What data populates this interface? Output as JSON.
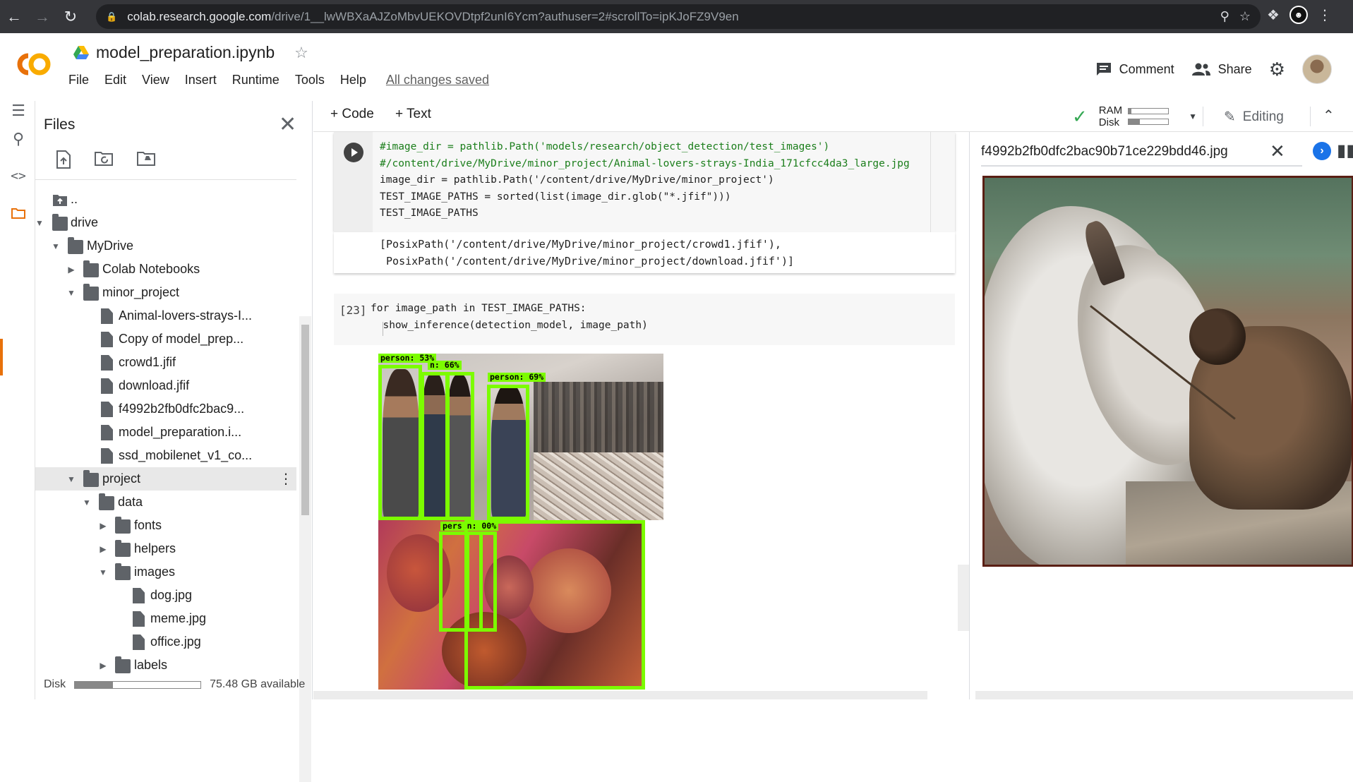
{
  "browser": {
    "url_host": "colab.research.google.com",
    "url_path": "/drive/1__lwWBXaAJZoMbvUEKOVDtpf2unI6Ycm?authuser=2#scrollTo=ipKJoFZ9V9en"
  },
  "header": {
    "doc_name": "model_preparation.ipynb",
    "menu": [
      "File",
      "Edit",
      "View",
      "Insert",
      "Runtime",
      "Tools",
      "Help"
    ],
    "saved_status": "All changes saved",
    "comment_label": "Comment",
    "share_label": "Share"
  },
  "files_panel": {
    "title": "Files",
    "disk_label": "Disk",
    "disk_available": "75.48 GB available",
    "disk_used_fraction": 0.3,
    "tree": [
      {
        "label": "..",
        "depth": 0,
        "kind": "up"
      },
      {
        "label": "drive",
        "depth": 0,
        "kind": "folder",
        "caret": "down"
      },
      {
        "label": "MyDrive",
        "depth": 1,
        "kind": "folder",
        "caret": "down"
      },
      {
        "label": "Colab Notebooks",
        "depth": 2,
        "kind": "folder",
        "caret": "right"
      },
      {
        "label": "minor_project",
        "depth": 2,
        "kind": "folder",
        "caret": "down"
      },
      {
        "label": "Animal-lovers-strays-I...",
        "depth": 3,
        "kind": "file"
      },
      {
        "label": "Copy of model_prep...",
        "depth": 3,
        "kind": "file"
      },
      {
        "label": "crowd1.jfif",
        "depth": 3,
        "kind": "file"
      },
      {
        "label": "download.jfif",
        "depth": 3,
        "kind": "file"
      },
      {
        "label": "f4992b2fb0dfc2bac9...",
        "depth": 3,
        "kind": "file"
      },
      {
        "label": "model_preparation.i...",
        "depth": 3,
        "kind": "file"
      },
      {
        "label": "ssd_mobilenet_v1_co...",
        "depth": 3,
        "kind": "file"
      },
      {
        "label": "project",
        "depth": 2,
        "kind": "folder",
        "caret": "down",
        "selected": true
      },
      {
        "label": "data",
        "depth": 3,
        "kind": "folder",
        "caret": "down"
      },
      {
        "label": "fonts",
        "depth": 4,
        "kind": "folder",
        "caret": "right"
      },
      {
        "label": "helpers",
        "depth": 4,
        "kind": "folder",
        "caret": "right"
      },
      {
        "label": "images",
        "depth": 4,
        "kind": "folder",
        "caret": "down"
      },
      {
        "label": "dog.jpg",
        "depth": 5,
        "kind": "file"
      },
      {
        "label": "meme.jpg",
        "depth": 5,
        "kind": "file"
      },
      {
        "label": "office.jpg",
        "depth": 5,
        "kind": "file"
      },
      {
        "label": "labels",
        "depth": 4,
        "kind": "folder",
        "caret": "right"
      }
    ]
  },
  "toolbar": {
    "code_label": "+ Code",
    "text_label": "+ Text",
    "ram_label": "RAM",
    "disk_label": "Disk",
    "ram_fraction": 0.06,
    "disk_fraction": 0.28,
    "editing_label": "Editing"
  },
  "cells": {
    "cell1_lines": [
      "#image_dir = pathlib.Path('models/research/object_detection/test_images')",
      "#/content/drive/MyDrive/minor_project/Animal-lovers-strays-India_171cfcc4da3_large.jpg",
      "image_dir = pathlib.Path('/content/drive/MyDrive/minor_project')",
      "TEST_IMAGE_PATHS = sorted(list(image_dir.glob(\"*.jfif\")))",
      "TEST_IMAGE_PATHS"
    ],
    "cell1_output": [
      "[PosixPath('/content/drive/MyDrive/minor_project/crowd1.jfif'),",
      " PosixPath('/content/drive/MyDrive/minor_project/download.jfif')]"
    ],
    "cell2_count": "[23]",
    "cell2_lines": [
      "for image_path in TEST_IMAGE_PATHS:",
      "  show_inference(detection_model, image_path)"
    ],
    "detections": [
      {
        "label": "person: 53%"
      },
      {
        "label": "n: 66%"
      },
      {
        "label": "person: 69%"
      },
      {
        "label": "pers n: 00%"
      }
    ]
  },
  "viewer": {
    "filename": "f4992b2fb0dfc2bac90b71ce229bdd46.jpg"
  },
  "colors": {
    "accent_orange": "#e8710a",
    "bbox_green": "#7cfc00",
    "check_green": "#34a853",
    "next_blue": "#1a73e8"
  }
}
